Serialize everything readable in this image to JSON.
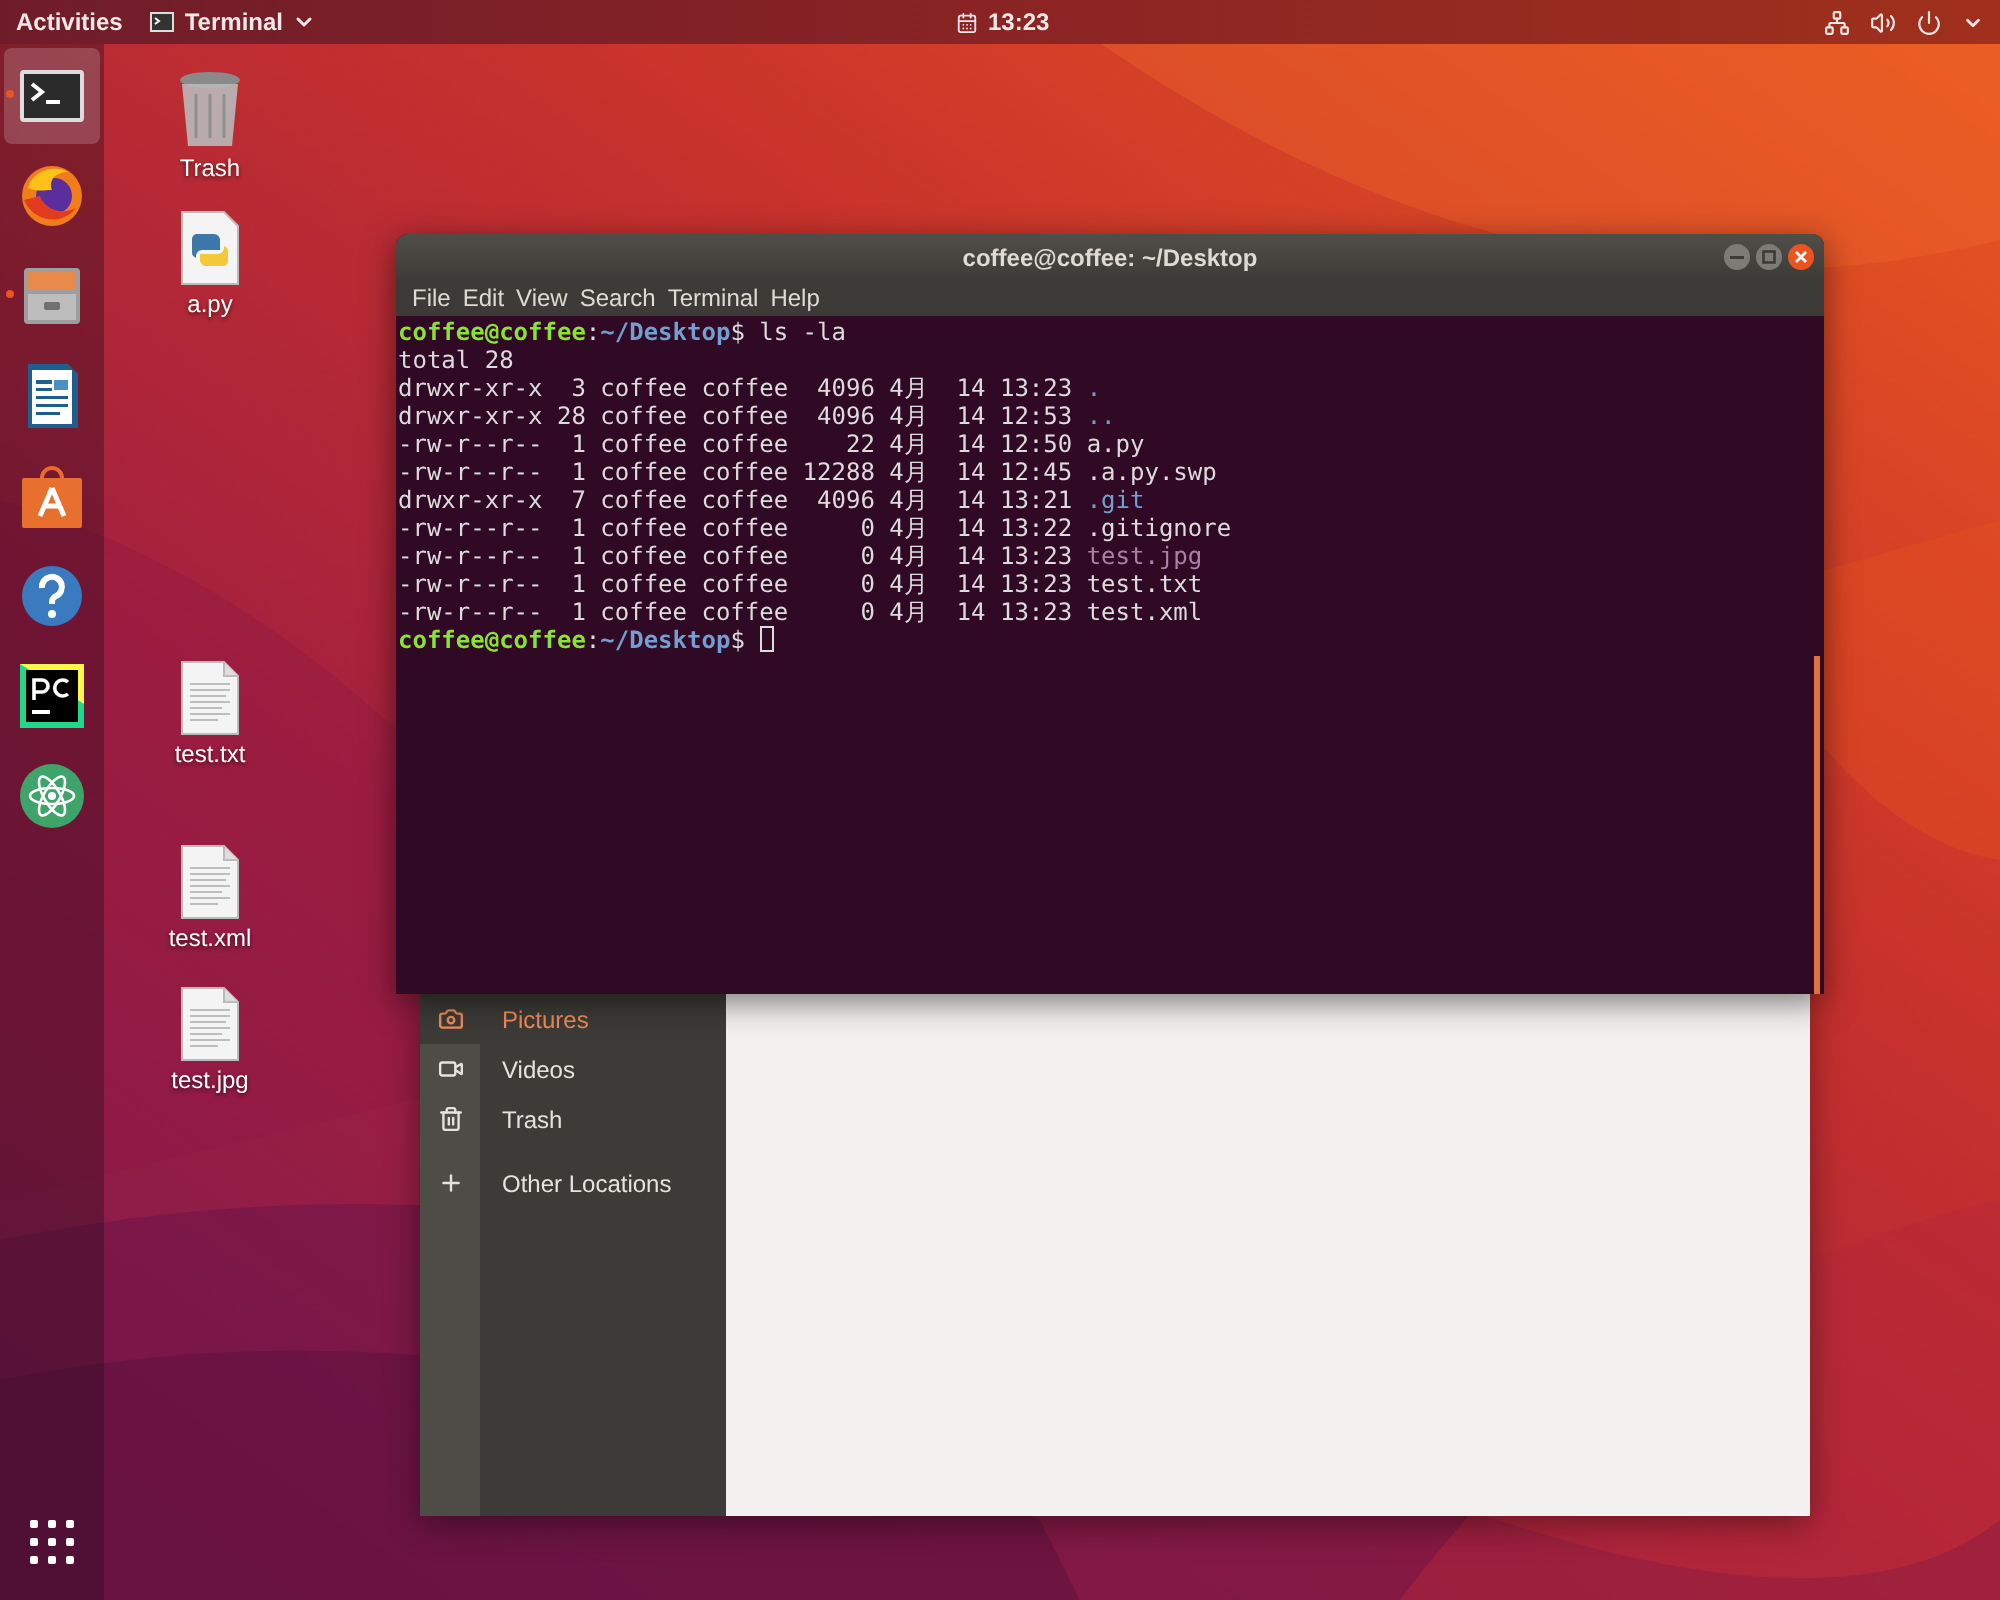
{
  "top_bar": {
    "activities": "Activities",
    "app_menu": "Terminal",
    "clock": "13:23"
  },
  "dock": {
    "items": [
      {
        "kind": "terminal",
        "selected": true,
        "running": true
      },
      {
        "kind": "browser",
        "selected": false,
        "running": false
      },
      {
        "kind": "files",
        "selected": false,
        "running": true
      },
      {
        "kind": "writer",
        "selected": false,
        "running": false
      },
      {
        "kind": "software",
        "selected": false,
        "running": false
      },
      {
        "kind": "help",
        "selected": false,
        "running": false
      },
      {
        "kind": "ide",
        "selected": false,
        "running": false
      },
      {
        "kind": "editor",
        "selected": false,
        "running": false
      }
    ]
  },
  "desktop_icons": [
    {
      "kind": "trash",
      "label": "Trash"
    },
    {
      "kind": "python",
      "label": "a.py"
    },
    {
      "kind": "text",
      "label": "test.txt"
    },
    {
      "kind": "text",
      "label": "test.xml"
    },
    {
      "kind": "text",
      "label": "test.jpg"
    }
  ],
  "terminal": {
    "title": "coffee@coffee: ~/Desktop",
    "menu": [
      "File",
      "Edit",
      "View",
      "Search",
      "Terminal",
      "Help"
    ],
    "lines": [
      {
        "kind": "prompt",
        "user_host": "coffee@coffee",
        "separator": ":",
        "path": "~/Desktop",
        "command": "$ ls -la",
        "cursor": false
      },
      {
        "kind": "output",
        "text": "total 28"
      },
      {
        "kind": "entry",
        "details": "drwxr-xr-x  3 coffee coffee  4096 4月  14 13:23",
        "name": ".",
        "color": "#729fcf"
      },
      {
        "kind": "entry",
        "details": "drwxr-xr-x 28 coffee coffee  4096 4月  14 12:53",
        "name": "..",
        "color": "#729fcf"
      },
      {
        "kind": "entry",
        "details": "-rw-r--r--  1 coffee coffee    22 4月  14 12:50",
        "name": "a.py",
        "color": "#dcdcdc"
      },
      {
        "kind": "entry",
        "details": "-rw-r--r--  1 coffee coffee 12288 4月  14 12:45",
        "name": ".a.py.swp",
        "color": "#dcdcdc"
      },
      {
        "kind": "entry",
        "details": "drwxr-xr-x  7 coffee coffee  4096 4月  14 13:21",
        "name": ".git",
        "color": "#729fcf"
      },
      {
        "kind": "entry",
        "details": "-rw-r--r--  1 coffee coffee     0 4月  14 13:22",
        "name": ".gitignore",
        "color": "#dcdcdc"
      },
      {
        "kind": "entry",
        "details": "-rw-r--r--  1 coffee coffee     0 4月  14 13:23",
        "name": "test.jpg",
        "color": "#ad7fa8"
      },
      {
        "kind": "entry",
        "details": "-rw-r--r--  1 coffee coffee     0 4月  14 13:23",
        "name": "test.txt",
        "color": "#dcdcdc"
      },
      {
        "kind": "entry",
        "details": "-rw-r--r--  1 coffee coffee     0 4月  14 13:23",
        "name": "test.xml",
        "color": "#dcdcdc"
      },
      {
        "kind": "prompt",
        "user_host": "coffee@coffee",
        "separator": ":",
        "path": "~/Desktop",
        "command": "$",
        "cursor": true
      }
    ]
  },
  "files_window": {
    "sidebar": [
      {
        "kind": "pictures",
        "label": "Pictures",
        "selected": true
      },
      {
        "kind": "videos",
        "label": "Videos",
        "selected": false
      },
      {
        "kind": "trash",
        "label": "Trash",
        "selected": false
      },
      {
        "kind": "other",
        "label": "Other Locations",
        "selected": false
      }
    ]
  }
}
